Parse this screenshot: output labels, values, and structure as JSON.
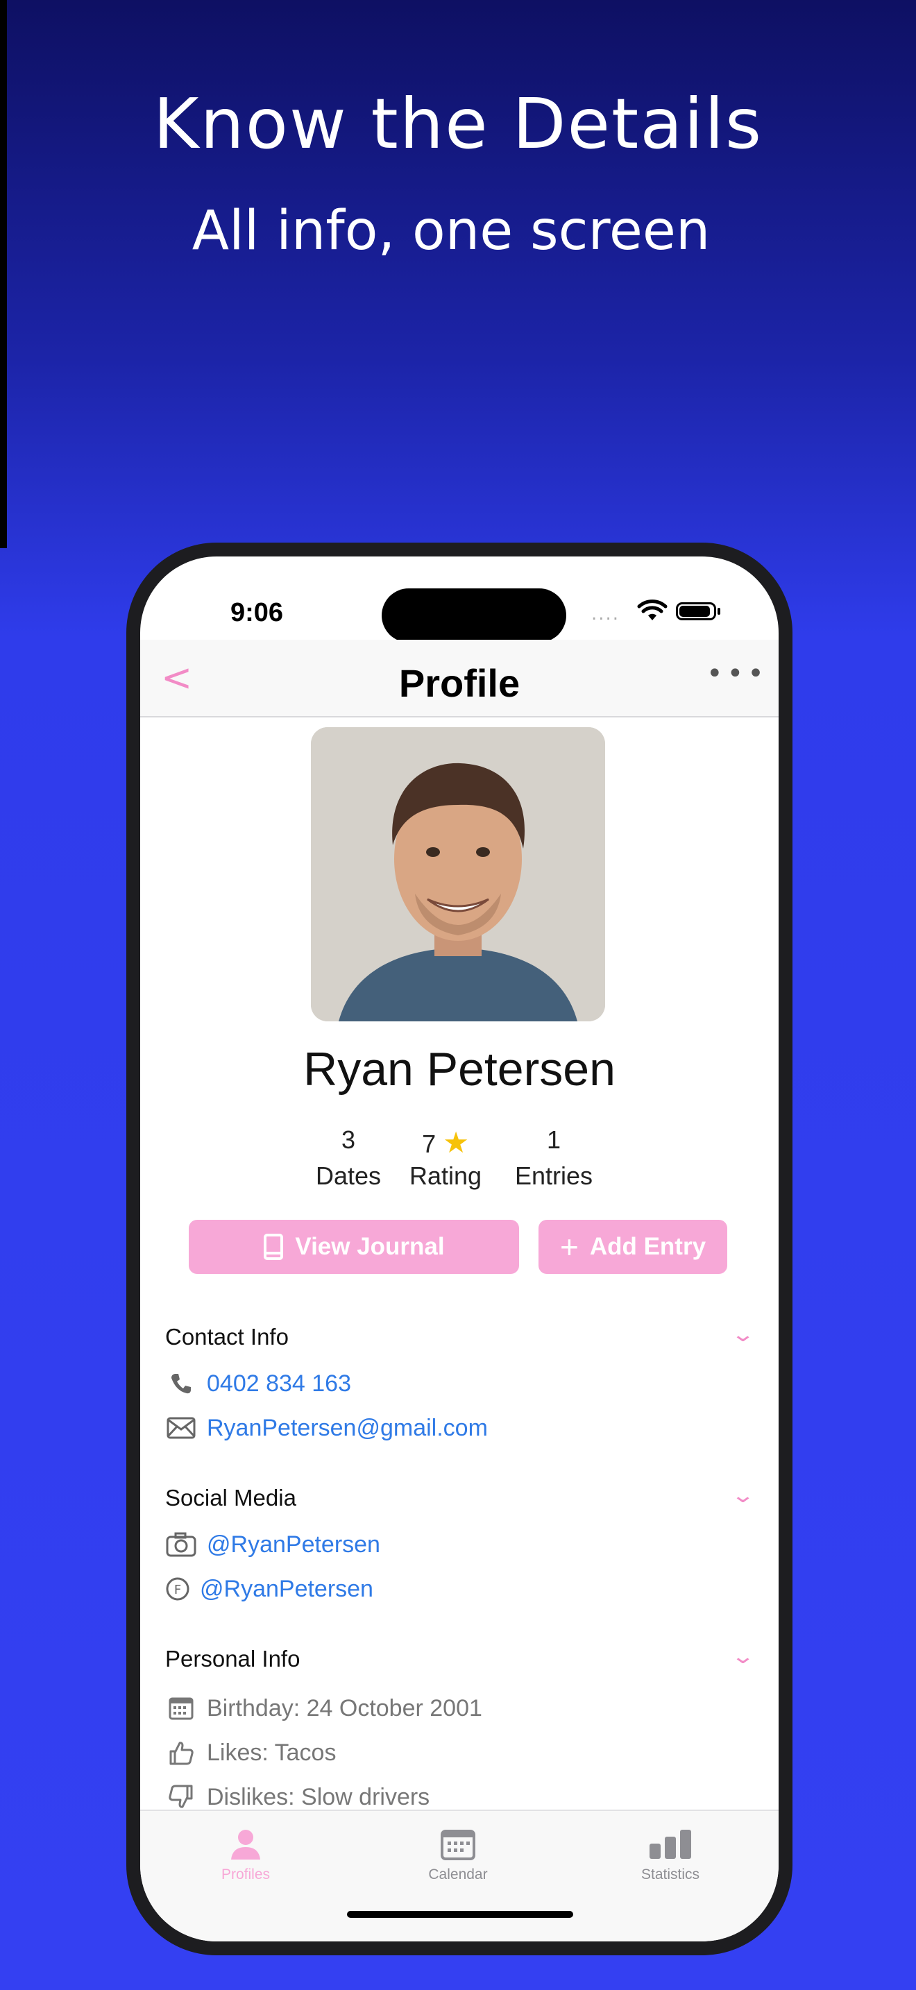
{
  "promo": {
    "headline": "Know the Details",
    "subheadline": "All info, one screen"
  },
  "status_bar": {
    "time": "9:06",
    "signal": "....",
    "icons": [
      "wifi-icon",
      "battery-icon"
    ]
  },
  "nav": {
    "back_icon": "chevron-left-icon",
    "back_glyph": "<",
    "title": "Profile",
    "more_glyph": "•••"
  },
  "profile": {
    "name": "Ryan Petersen",
    "stats": [
      {
        "value": "3",
        "label": "Dates"
      },
      {
        "value": "7",
        "label": "Rating",
        "icon": "star-icon"
      },
      {
        "value": "1",
        "label": "Entries"
      }
    ]
  },
  "actions": {
    "view_journal": "View Journal",
    "add_entry": "Add Entry"
  },
  "sections": {
    "contact": {
      "title": "Contact Info",
      "phone": "0402 834 163",
      "email": "RyanPetersen@gmail.com"
    },
    "social": {
      "title": "Social Media",
      "instagram": "@RyanPetersen",
      "facebook": "@RyanPetersen"
    },
    "personal": {
      "title": "Personal Info",
      "birthday": "Birthday: 24 October 2001",
      "likes": "Likes: Tacos",
      "dislikes": "Dislikes: Slow drivers"
    }
  },
  "tabs": [
    {
      "label": "Profiles",
      "icon": "person-icon",
      "active": true
    },
    {
      "label": "Calendar",
      "icon": "calendar-icon",
      "active": false
    },
    {
      "label": "Statistics",
      "icon": "bar-chart-icon",
      "active": false
    }
  ],
  "colors": {
    "accent_pink": "#f7a8d7",
    "link_blue": "#2f7ae6",
    "star_yellow": "#f6c20a",
    "background_blue": "#3440f2"
  }
}
